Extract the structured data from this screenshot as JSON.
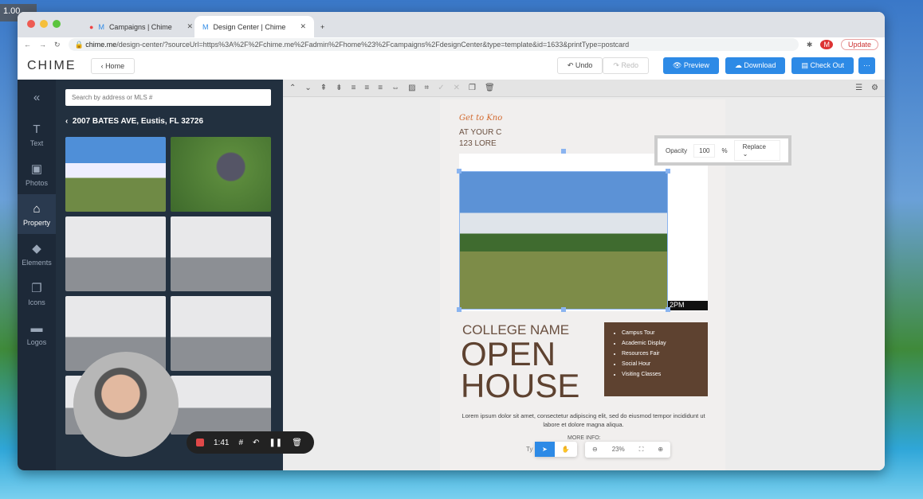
{
  "overlay": {
    "timer": "1.00"
  },
  "browser": {
    "tabs": [
      {
        "label": "Campaigns | Chime"
      },
      {
        "label": "Design Center | Chime"
      }
    ],
    "url_domain": "chime.me",
    "url_path": "/design-center/?sourceUrl=https%3A%2F%2Fchime.me%2Fadmin%2Fhome%23%2Fcampaigns%2FdesignCenter&type=template&id=1633&printType=postcard",
    "update_label": "Update",
    "profile_initial": "M"
  },
  "header": {
    "logo": "CHIME",
    "home_label": "Home",
    "undo_label": "Undo",
    "redo_label": "Redo",
    "preview_label": "Preview",
    "download_label": "Download",
    "checkout_label": "Check Out"
  },
  "rail": {
    "items": [
      {
        "label": "Text",
        "icon": "T"
      },
      {
        "label": "Photos",
        "icon": "▣"
      },
      {
        "label": "Property",
        "icon": "⌂"
      },
      {
        "label": "Elements",
        "icon": "◆"
      },
      {
        "label": "Icons",
        "icon": "❐"
      },
      {
        "label": "Logos",
        "icon": "▬"
      }
    ]
  },
  "panel": {
    "search_placeholder": "Search by address or MLS #",
    "address": "2007 BATES AVE, Eustis, FL 32726"
  },
  "popup": {
    "opacity_label": "Opacity",
    "opacity_value": "100",
    "unit": "%",
    "replace_label": "Replace"
  },
  "flyer": {
    "script": "Get to Kno",
    "line1": "AT YOUR C",
    "line2": "123 LORE",
    "time_fragment": "2PM",
    "college": "COLLEGE NAME",
    "open": "OPEN",
    "house": "HOUSE",
    "list": [
      "Campus Tour",
      "Academic Display",
      "Resources Fair",
      "Social Hour",
      "Visiting Classes"
    ],
    "lorem": "Lorem ipsum dolor sit amet, consectetur adipiscing elit, sed do eiusmod tempor incididunt ut labore et dolore magna aliqua.",
    "more_info": "MORE INFO:",
    "ty": "Ty"
  },
  "zoom": {
    "level": "23%"
  },
  "recorder": {
    "time": "1:41"
  },
  "colors": {
    "accent": "#2d8ae6",
    "brown": "#5e4230",
    "rail": "#1d2938"
  }
}
